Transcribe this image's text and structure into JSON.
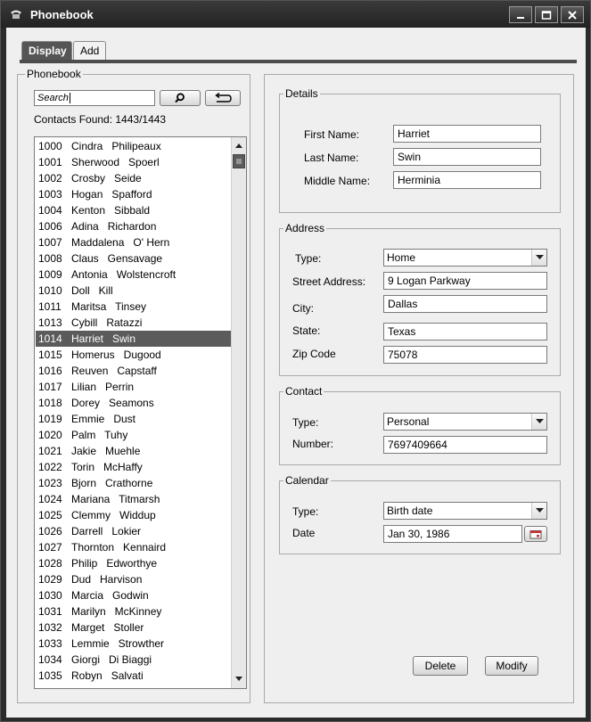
{
  "window": {
    "title": "Phonebook",
    "icon": "phone-icon",
    "controls": [
      "minimize-icon",
      "maximize-icon",
      "close-icon"
    ]
  },
  "tabs": [
    {
      "label": "Display",
      "active": true
    },
    {
      "label": "Add",
      "active": false
    }
  ],
  "phonebook": {
    "group_label": "Phonebook",
    "search_placeholder": "Search",
    "search_value": "",
    "search_icon": "magnifier-icon",
    "reset_icon": "undo-arrow-icon",
    "contacts_found": "Contacts Found: 1443/1443",
    "selected_id": "1014",
    "items": [
      {
        "id": "1000",
        "name": "Cindra   Philipeaux"
      },
      {
        "id": "1001",
        "name": "Sherwood   Spoerl"
      },
      {
        "id": "1002",
        "name": "Crosby   Seide"
      },
      {
        "id": "1003",
        "name": "Hogan   Spafford"
      },
      {
        "id": "1004",
        "name": "Kenton   Sibbald"
      },
      {
        "id": "1006",
        "name": "Adina   Richardon"
      },
      {
        "id": "1007",
        "name": "Maddalena   O' Hern"
      },
      {
        "id": "1008",
        "name": "Claus   Gensavage"
      },
      {
        "id": "1009",
        "name": "Antonia   Wolstencroft"
      },
      {
        "id": "1010",
        "name": "Doll   Kill"
      },
      {
        "id": "1011",
        "name": "Maritsa   Tinsey"
      },
      {
        "id": "1013",
        "name": "Cybill   Ratazzi"
      },
      {
        "id": "1014",
        "name": "Harriet   Swin"
      },
      {
        "id": "1015",
        "name": "Homerus   Dugood"
      },
      {
        "id": "1016",
        "name": "Reuven   Capstaff"
      },
      {
        "id": "1017",
        "name": "Lilian   Perrin"
      },
      {
        "id": "1018",
        "name": "Dorey   Seamons"
      },
      {
        "id": "1019",
        "name": "Emmie   Dust"
      },
      {
        "id": "1020",
        "name": "Palm   Tuhy"
      },
      {
        "id": "1021",
        "name": "Jakie   Muehle"
      },
      {
        "id": "1022",
        "name": "Torin   McHaffy"
      },
      {
        "id": "1023",
        "name": "Bjorn   Crathorne"
      },
      {
        "id": "1024",
        "name": "Mariana   Titmarsh"
      },
      {
        "id": "1025",
        "name": "Clemmy   Widdup"
      },
      {
        "id": "1026",
        "name": "Darrell   Lokier"
      },
      {
        "id": "1027",
        "name": "Thornton   Kennaird"
      },
      {
        "id": "1028",
        "name": "Philip   Edworthye"
      },
      {
        "id": "1029",
        "name": "Dud   Harvison"
      },
      {
        "id": "1030",
        "name": "Marcia   Godwin"
      },
      {
        "id": "1031",
        "name": "Marilyn   McKinney"
      },
      {
        "id": "1032",
        "name": "Marget   Stoller"
      },
      {
        "id": "1033",
        "name": "Lemmie   Strowther"
      },
      {
        "id": "1034",
        "name": "Giorgi   Di Biaggi"
      },
      {
        "id": "1035",
        "name": "Robyn   Salvati"
      }
    ]
  },
  "details": {
    "group_label": "Details",
    "first_name_label": "First Name:",
    "first_name": "Harriet",
    "last_name_label": "Last Name:",
    "last_name": "Swin",
    "middle_name_label": "Middle Name:",
    "middle_name": "Herminia"
  },
  "address": {
    "group_label": "Address",
    "type_label": "Type:",
    "type": "Home",
    "street_label": "Street Address:",
    "street": "9 Logan Parkway",
    "city_label": "City:",
    "city": "Dallas",
    "state_label": "State:",
    "state": "Texas",
    "zip_label": "Zip Code",
    "zip": "75078"
  },
  "contact": {
    "group_label": "Contact",
    "type_label": "Type:",
    "type": "Personal",
    "number_label": "Number:",
    "number": "7697409664"
  },
  "calendar": {
    "group_label": "Calendar",
    "type_label": "Type:",
    "type": "Birth date",
    "date_label": "Date",
    "date": "Jan 30, 1986",
    "calendar_icon": "calendar-icon"
  },
  "actions": {
    "delete_label": "Delete",
    "modify_label": "Modify"
  }
}
